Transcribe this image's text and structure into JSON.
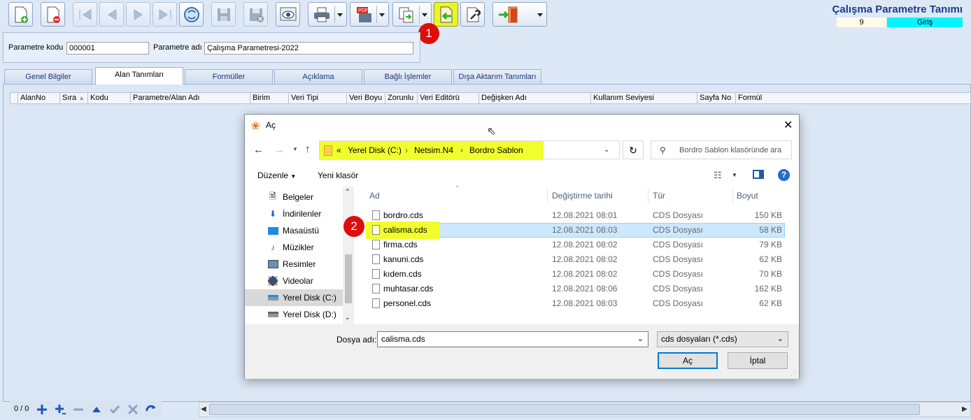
{
  "app": {
    "title": "Çalışma Parametre Tanımı",
    "status_number": "9",
    "status_mode": "Giriş"
  },
  "annotations": [
    "1",
    "2"
  ],
  "params": {
    "code_label": "Parametre kodu",
    "code_value": "000001",
    "name_label": "Parametre adı",
    "name_value": "Çalışma Parametresi-2022"
  },
  "tabs": [
    "Genel Bilgiler",
    "Alan Tanımları",
    "Formüller",
    "Açıklama",
    "Bağlı İşlemler",
    "Dışa Aktarım Tanımları"
  ],
  "active_tab": "Alan Tanımları",
  "grid": {
    "columns": [
      "AlanNo",
      "Sıra",
      "Kodu",
      "Parametre/Alan Adı",
      "Birim",
      "Veri Tipi",
      "Veri Boyu",
      "Zorunlu",
      "Veri Editörü",
      "Değişken Adı",
      "Kullanım Seviyesi",
      "Sayfa No",
      "Formül"
    ]
  },
  "navigator": {
    "record_count": "0 / 0"
  },
  "dialog": {
    "title": "Aç",
    "path": [
      "«",
      "Yerel Disk (C:)",
      "Netsim.N4",
      "Bordro Sablon"
    ],
    "search_placeholder": "Bordro Sablon klasöründe ara",
    "organize_label": "Düzenle",
    "new_folder_label": "Yeni klasör",
    "help_glyph": "?",
    "nav_items": [
      {
        "label": "Belgeler",
        "icon": "document-icon"
      },
      {
        "label": "İndirilenler",
        "icon": "download-icon"
      },
      {
        "label": "Masaüstü",
        "icon": "desktop-icon"
      },
      {
        "label": "Müzikler",
        "icon": "music-icon"
      },
      {
        "label": "Resimler",
        "icon": "picture-icon"
      },
      {
        "label": "Videolar",
        "icon": "video-icon"
      },
      {
        "label": "Yerel Disk (C:)",
        "icon": "drive-icon"
      },
      {
        "label": "Yerel Disk (D:)",
        "icon": "drive-icon"
      }
    ],
    "selected_nav": "Yerel Disk (C:)",
    "columns": [
      "Ad",
      "Değiştirme tarihi",
      "Tür",
      "Boyut"
    ],
    "files": [
      {
        "name": "bordro.cds",
        "date": "12.08.2021 08:01",
        "type": "CDS Dosyası",
        "size": "150 KB"
      },
      {
        "name": "calisma.cds",
        "date": "12.08.2021 08:03",
        "type": "CDS Dosyası",
        "size": "58 KB"
      },
      {
        "name": "firma.cds",
        "date": "12.08.2021 08:02",
        "type": "CDS Dosyası",
        "size": "79 KB"
      },
      {
        "name": "kanuni.cds",
        "date": "12.08.2021 08:02",
        "type": "CDS Dosyası",
        "size": "62 KB"
      },
      {
        "name": "kıdem.cds",
        "date": "12.08.2021 08:02",
        "type": "CDS Dosyası",
        "size": "70 KB"
      },
      {
        "name": "muhtasar.cds",
        "date": "12.08.2021 08:06",
        "type": "CDS Dosyası",
        "size": "162 KB"
      },
      {
        "name": "personel.cds",
        "date": "12.08.2021 08:03",
        "type": "CDS Dosyası",
        "size": "62 KB"
      }
    ],
    "selected_file": "calisma.cds",
    "filename_label": "Dosya adı:",
    "filename_value": "calisma.cds",
    "filetype_value": "cds dosyaları (*.cds)",
    "open_label": "Aç",
    "cancel_label": "İptal"
  },
  "colors": {
    "highlight_yellow": "#f0ff2d",
    "marker_red": "#e00d0d",
    "title_blue": "#1b3a8c",
    "status_cyan": "#00f5ff",
    "selection_blue": "#cce8ff"
  }
}
